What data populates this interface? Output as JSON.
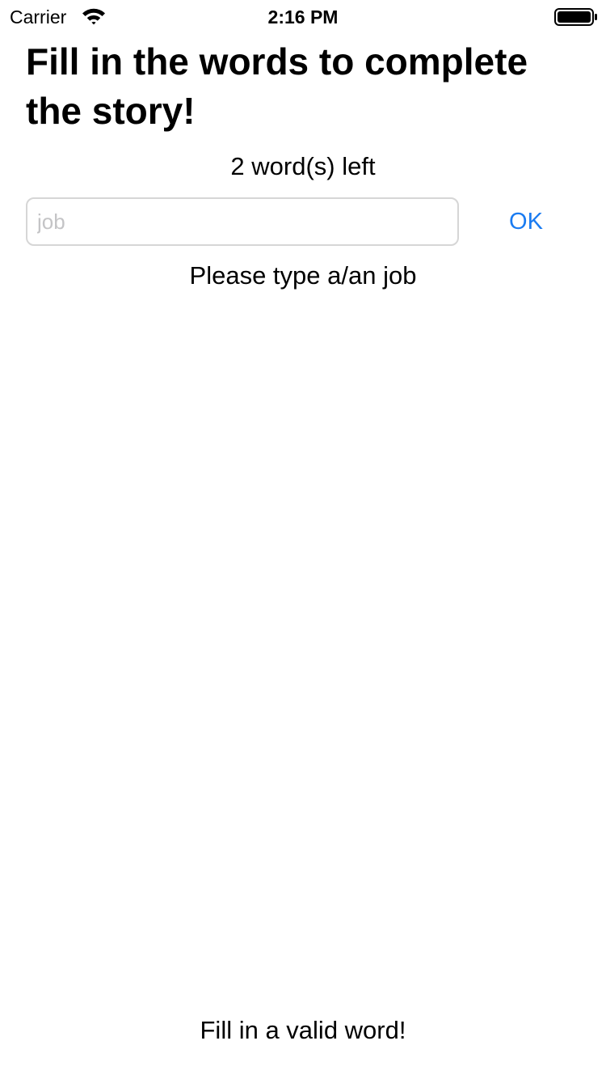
{
  "status_bar": {
    "carrier": "Carrier",
    "time": "2:16 PM",
    "icons": [
      "wifi-icon",
      "battery-icon"
    ]
  },
  "main": {
    "title": "Fill in the words to complete the story!",
    "words_left": "2 word(s) left",
    "input": {
      "placeholder": "job",
      "value": ""
    },
    "ok_label": "OK",
    "prompt": "Please type a/an job",
    "validation_message": "Fill in a valid word!"
  },
  "colors": {
    "accent": "#1a7bf1",
    "text": "#000000",
    "placeholder": "#c4c4c6",
    "input_border": "#d6d6d6",
    "background": "#ffffff"
  }
}
